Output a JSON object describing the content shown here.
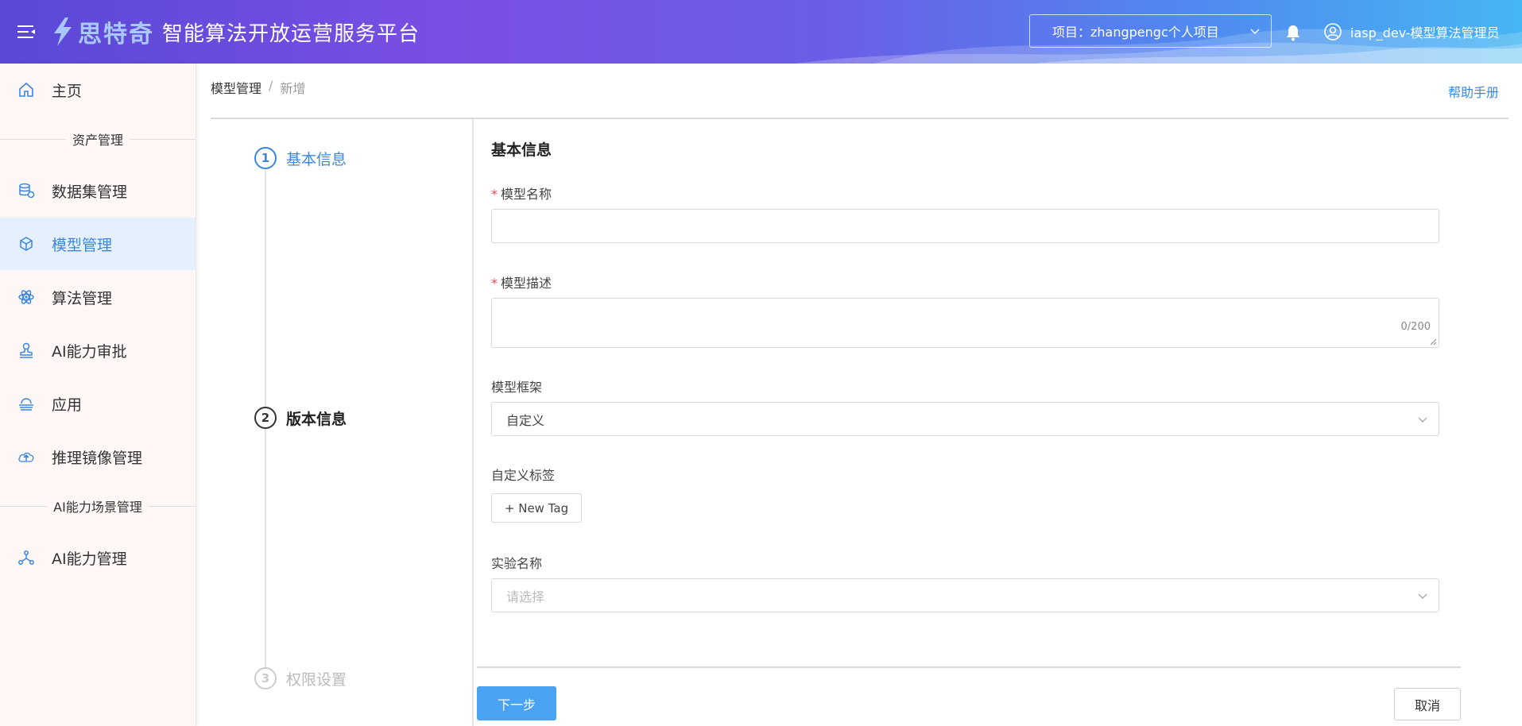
{
  "header": {
    "brand": "思特奇",
    "title": "智能算法开放运营服务平台",
    "project_label": "项目：zhangpengc个人项目",
    "user_label": "iasp_dev-模型算法管理员"
  },
  "sidebar": {
    "home": "主页",
    "section_assets": "资产管理",
    "items": [
      {
        "label": "数据集管理",
        "icon": "database-icon"
      },
      {
        "label": "模型管理",
        "icon": "cube-icon"
      },
      {
        "label": "算法管理",
        "icon": "atom-icon"
      },
      {
        "label": "AI能力审批",
        "icon": "stamp-icon"
      },
      {
        "label": "应用",
        "icon": "cloud-stack-icon"
      },
      {
        "label": "推理镜像管理",
        "icon": "cloud-upload-icon"
      }
    ],
    "section_scene": "AI能力场景管理",
    "ai_capability": "AI能力管理",
    "active_item": "模型管理"
  },
  "breadcrumb": {
    "parent": "模型管理",
    "separator": "/",
    "current": "新增"
  },
  "help": "帮助手册",
  "steps": [
    {
      "num": "1",
      "label": "基本信息"
    },
    {
      "num": "2",
      "label": "版本信息"
    },
    {
      "num": "3",
      "label": "权限设置"
    }
  ],
  "form": {
    "title": "基本信息",
    "required_mark": "*",
    "name_label": "模型名称",
    "name_value": "",
    "desc_label": "模型描述",
    "desc_value": "",
    "desc_count": "0/200",
    "framework_label": "模型框架",
    "framework_value": "自定义",
    "tags_label": "自定义标签",
    "new_tag": "+ New Tag",
    "experiment_label": "实验名称",
    "experiment_placeholder": "请选择"
  },
  "actions": {
    "next": "下一步",
    "cancel": "取消"
  },
  "colors": {
    "accent": "#3b87e0",
    "primary_button": "#4aa3f2",
    "required": "#e5484d"
  }
}
